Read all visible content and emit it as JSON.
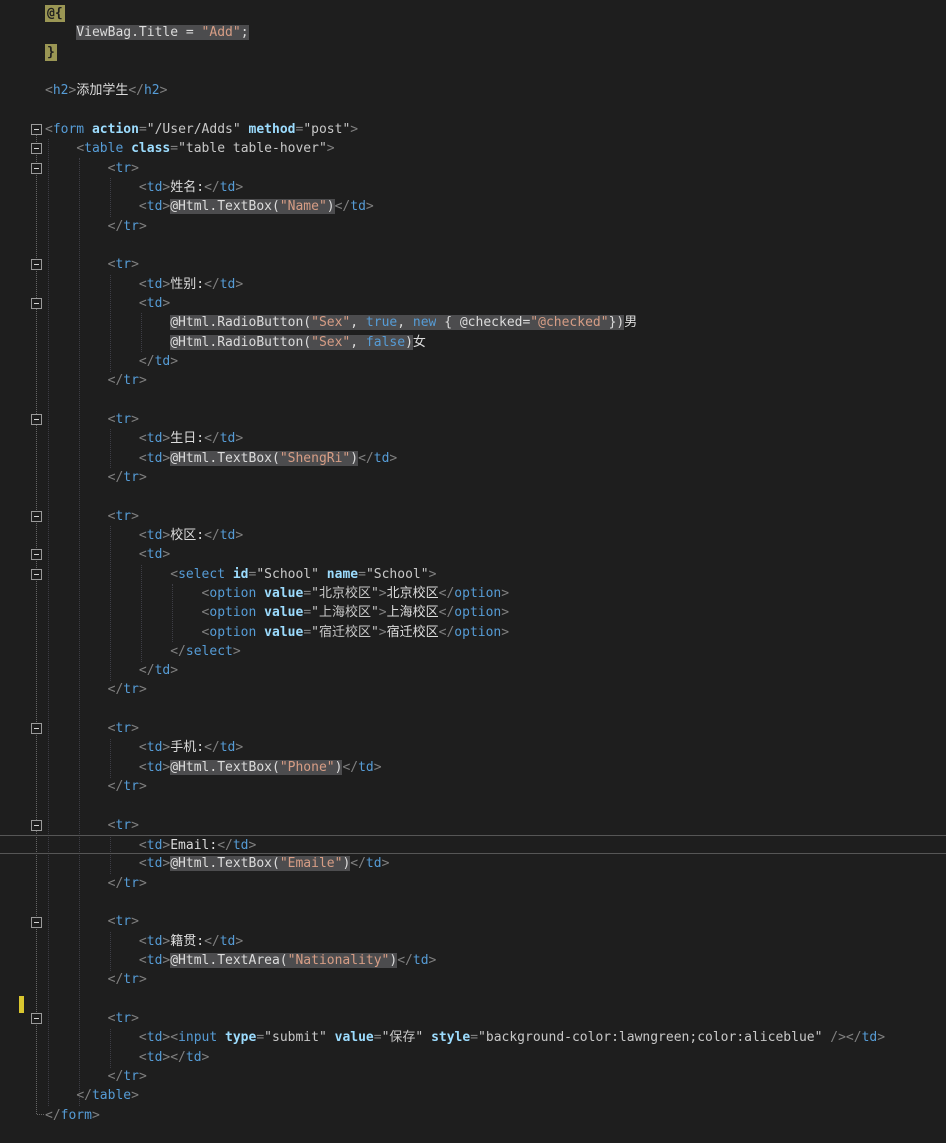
{
  "editor": {
    "file_type": "razor-cshtml-view",
    "current_line": 44,
    "modified_marker_line": 52,
    "fold_boxes": [
      7,
      8,
      9,
      14,
      16,
      22,
      27,
      29,
      30,
      38,
      43,
      48,
      53
    ],
    "colors": {
      "background": "#1e1e1e",
      "html_tag": "#569cd6",
      "html_delimiter": "#808080",
      "html_attribute": "#9cdcfe",
      "html_attribute_value": "#c8c8c8",
      "html_text": "#dcdcdc",
      "razor_background": "#4c4c4e",
      "razor_string": "#d69d85",
      "razor_keyword": "#569cd6",
      "razor_transition_background": "#9a9654",
      "current_line_border": "#565656",
      "modified_marker": "#d9c62f"
    },
    "lines": [
      [
        [
          "tr",
          "@{"
        ]
      ],
      [
        [
          "x",
          "    "
        ],
        [
          "rz",
          "ViewBag.Title = "
        ],
        [
          "rs",
          "\"Add\""
        ],
        [
          "rz",
          ";"
        ]
      ],
      [
        [
          "tr",
          "}"
        ]
      ],
      [],
      [
        [
          "d",
          "<"
        ],
        [
          "t",
          "h2"
        ],
        [
          "d",
          ">"
        ],
        [
          "x",
          "添加学生"
        ],
        [
          "d",
          "</"
        ],
        [
          "t",
          "h2"
        ],
        [
          "d",
          ">"
        ]
      ],
      [],
      [
        [
          "d",
          "<"
        ],
        [
          "t",
          "form"
        ],
        [
          "x",
          " "
        ],
        [
          "a",
          "action"
        ],
        [
          "d",
          "="
        ],
        [
          "v",
          "\"/User/Adds\""
        ],
        [
          "x",
          " "
        ],
        [
          "a",
          "method"
        ],
        [
          "d",
          "="
        ],
        [
          "v",
          "\"post\""
        ],
        [
          "d",
          ">"
        ]
      ],
      [
        [
          "x",
          "    "
        ],
        [
          "d",
          "<"
        ],
        [
          "t",
          "table"
        ],
        [
          "x",
          " "
        ],
        [
          "a",
          "class"
        ],
        [
          "d",
          "="
        ],
        [
          "v",
          "\"table table-hover\""
        ],
        [
          "d",
          ">"
        ]
      ],
      [
        [
          "x",
          "        "
        ],
        [
          "d",
          "<"
        ],
        [
          "t",
          "tr"
        ],
        [
          "d",
          ">"
        ]
      ],
      [
        [
          "x",
          "            "
        ],
        [
          "d",
          "<"
        ],
        [
          "t",
          "td"
        ],
        [
          "d",
          ">"
        ],
        [
          "x",
          "姓名:"
        ],
        [
          "d",
          "</"
        ],
        [
          "t",
          "td"
        ],
        [
          "d",
          ">"
        ]
      ],
      [
        [
          "x",
          "            "
        ],
        [
          "d",
          "<"
        ],
        [
          "t",
          "td"
        ],
        [
          "d",
          ">"
        ],
        [
          "rz",
          "@Html.TextBox("
        ],
        [
          "rs",
          "\"Name\""
        ],
        [
          "rz",
          ")"
        ],
        [
          "d",
          "</"
        ],
        [
          "t",
          "td"
        ],
        [
          "d",
          ">"
        ]
      ],
      [
        [
          "x",
          "        "
        ],
        [
          "d",
          "</"
        ],
        [
          "t",
          "tr"
        ],
        [
          "d",
          ">"
        ]
      ],
      [],
      [
        [
          "x",
          "        "
        ],
        [
          "d",
          "<"
        ],
        [
          "t",
          "tr"
        ],
        [
          "d",
          ">"
        ]
      ],
      [
        [
          "x",
          "            "
        ],
        [
          "d",
          "<"
        ],
        [
          "t",
          "td"
        ],
        [
          "d",
          ">"
        ],
        [
          "x",
          "性别:"
        ],
        [
          "d",
          "</"
        ],
        [
          "t",
          "td"
        ],
        [
          "d",
          ">"
        ]
      ],
      [
        [
          "x",
          "            "
        ],
        [
          "d",
          "<"
        ],
        [
          "t",
          "td"
        ],
        [
          "d",
          ">"
        ]
      ],
      [
        [
          "x",
          "                "
        ],
        [
          "rz",
          "@Html.RadioButton("
        ],
        [
          "rs",
          "\"Sex\""
        ],
        [
          "rz",
          ", "
        ],
        [
          "rk",
          "true"
        ],
        [
          "rz",
          ", "
        ],
        [
          "rk",
          "new"
        ],
        [
          "rz",
          " { @checked="
        ],
        [
          "rs",
          "\"@checked\""
        ],
        [
          "rz",
          "})"
        ],
        [
          "x",
          "男"
        ]
      ],
      [
        [
          "x",
          "                "
        ],
        [
          "rz",
          "@Html.RadioButton("
        ],
        [
          "rs",
          "\"Sex\""
        ],
        [
          "rz",
          ", "
        ],
        [
          "rk",
          "false"
        ],
        [
          "rz",
          ")"
        ],
        [
          "x",
          "女"
        ]
      ],
      [
        [
          "x",
          "            "
        ],
        [
          "d",
          "</"
        ],
        [
          "t",
          "td"
        ],
        [
          "d",
          ">"
        ]
      ],
      [
        [
          "x",
          "        "
        ],
        [
          "d",
          "</"
        ],
        [
          "t",
          "tr"
        ],
        [
          "d",
          ">"
        ]
      ],
      [],
      [
        [
          "x",
          "        "
        ],
        [
          "d",
          "<"
        ],
        [
          "t",
          "tr"
        ],
        [
          "d",
          ">"
        ]
      ],
      [
        [
          "x",
          "            "
        ],
        [
          "d",
          "<"
        ],
        [
          "t",
          "td"
        ],
        [
          "d",
          ">"
        ],
        [
          "x",
          "生日:"
        ],
        [
          "d",
          "</"
        ],
        [
          "t",
          "td"
        ],
        [
          "d",
          ">"
        ]
      ],
      [
        [
          "x",
          "            "
        ],
        [
          "d",
          "<"
        ],
        [
          "t",
          "td"
        ],
        [
          "d",
          ">"
        ],
        [
          "rz",
          "@Html.TextBox("
        ],
        [
          "rs",
          "\"ShengRi\""
        ],
        [
          "rz",
          ")"
        ],
        [
          "d",
          "</"
        ],
        [
          "t",
          "td"
        ],
        [
          "d",
          ">"
        ]
      ],
      [
        [
          "x",
          "        "
        ],
        [
          "d",
          "</"
        ],
        [
          "t",
          "tr"
        ],
        [
          "d",
          ">"
        ]
      ],
      [],
      [
        [
          "x",
          "        "
        ],
        [
          "d",
          "<"
        ],
        [
          "t",
          "tr"
        ],
        [
          "d",
          ">"
        ]
      ],
      [
        [
          "x",
          "            "
        ],
        [
          "d",
          "<"
        ],
        [
          "t",
          "td"
        ],
        [
          "d",
          ">"
        ],
        [
          "x",
          "校区:"
        ],
        [
          "d",
          "</"
        ],
        [
          "t",
          "td"
        ],
        [
          "d",
          ">"
        ]
      ],
      [
        [
          "x",
          "            "
        ],
        [
          "d",
          "<"
        ],
        [
          "t",
          "td"
        ],
        [
          "d",
          ">"
        ]
      ],
      [
        [
          "x",
          "                "
        ],
        [
          "d",
          "<"
        ],
        [
          "t",
          "select"
        ],
        [
          "x",
          " "
        ],
        [
          "a",
          "id"
        ],
        [
          "d",
          "="
        ],
        [
          "v",
          "\"School\""
        ],
        [
          "x",
          " "
        ],
        [
          "a",
          "name"
        ],
        [
          "d",
          "="
        ],
        [
          "v",
          "\"School\""
        ],
        [
          "d",
          ">"
        ]
      ],
      [
        [
          "x",
          "                    "
        ],
        [
          "d",
          "<"
        ],
        [
          "t",
          "option"
        ],
        [
          "x",
          " "
        ],
        [
          "a",
          "value"
        ],
        [
          "d",
          "="
        ],
        [
          "v",
          "\"北京校区\""
        ],
        [
          "d",
          ">"
        ],
        [
          "x",
          "北京校区"
        ],
        [
          "d",
          "</"
        ],
        [
          "t",
          "option"
        ],
        [
          "d",
          ">"
        ]
      ],
      [
        [
          "x",
          "                    "
        ],
        [
          "d",
          "<"
        ],
        [
          "t",
          "option"
        ],
        [
          "x",
          " "
        ],
        [
          "a",
          "value"
        ],
        [
          "d",
          "="
        ],
        [
          "v",
          "\"上海校区\""
        ],
        [
          "d",
          ">"
        ],
        [
          "x",
          "上海校区"
        ],
        [
          "d",
          "</"
        ],
        [
          "t",
          "option"
        ],
        [
          "d",
          ">"
        ]
      ],
      [
        [
          "x",
          "                    "
        ],
        [
          "d",
          "<"
        ],
        [
          "t",
          "option"
        ],
        [
          "x",
          " "
        ],
        [
          "a",
          "value"
        ],
        [
          "d",
          "="
        ],
        [
          "v",
          "\"宿迁校区\""
        ],
        [
          "d",
          ">"
        ],
        [
          "x",
          "宿迁校区"
        ],
        [
          "d",
          "</"
        ],
        [
          "t",
          "option"
        ],
        [
          "d",
          ">"
        ]
      ],
      [
        [
          "x",
          "                "
        ],
        [
          "d",
          "</"
        ],
        [
          "t",
          "select"
        ],
        [
          "d",
          ">"
        ]
      ],
      [
        [
          "x",
          "            "
        ],
        [
          "d",
          "</"
        ],
        [
          "t",
          "td"
        ],
        [
          "d",
          ">"
        ]
      ],
      [
        [
          "x",
          "        "
        ],
        [
          "d",
          "</"
        ],
        [
          "t",
          "tr"
        ],
        [
          "d",
          ">"
        ]
      ],
      [],
      [
        [
          "x",
          "        "
        ],
        [
          "d",
          "<"
        ],
        [
          "t",
          "tr"
        ],
        [
          "d",
          ">"
        ]
      ],
      [
        [
          "x",
          "            "
        ],
        [
          "d",
          "<"
        ],
        [
          "t",
          "td"
        ],
        [
          "d",
          ">"
        ],
        [
          "x",
          "手机:"
        ],
        [
          "d",
          "</"
        ],
        [
          "t",
          "td"
        ],
        [
          "d",
          ">"
        ]
      ],
      [
        [
          "x",
          "            "
        ],
        [
          "d",
          "<"
        ],
        [
          "t",
          "td"
        ],
        [
          "d",
          ">"
        ],
        [
          "rz",
          "@Html.TextBox("
        ],
        [
          "rs",
          "\"Phone\""
        ],
        [
          "rz",
          ")"
        ],
        [
          "d",
          "</"
        ],
        [
          "t",
          "td"
        ],
        [
          "d",
          ">"
        ]
      ],
      [
        [
          "x",
          "        "
        ],
        [
          "d",
          "</"
        ],
        [
          "t",
          "tr"
        ],
        [
          "d",
          ">"
        ]
      ],
      [],
      [
        [
          "x",
          "        "
        ],
        [
          "d",
          "<"
        ],
        [
          "t",
          "tr"
        ],
        [
          "d",
          ">"
        ]
      ],
      [
        [
          "x",
          "            "
        ],
        [
          "d",
          "<"
        ],
        [
          "t",
          "td"
        ],
        [
          "d",
          ">"
        ],
        [
          "x",
          "Email:"
        ],
        [
          "d",
          "</"
        ],
        [
          "t",
          "td"
        ],
        [
          "d",
          ">"
        ]
      ],
      [
        [
          "x",
          "            "
        ],
        [
          "d",
          "<"
        ],
        [
          "t",
          "td"
        ],
        [
          "d",
          ">"
        ],
        [
          "rz",
          "@Html.TextBox("
        ],
        [
          "rs",
          "\"Emaile\""
        ],
        [
          "rz",
          ")"
        ],
        [
          "d",
          "</"
        ],
        [
          "t",
          "td"
        ],
        [
          "d",
          ">"
        ]
      ],
      [
        [
          "x",
          "        "
        ],
        [
          "d",
          "</"
        ],
        [
          "t",
          "tr"
        ],
        [
          "d",
          ">"
        ]
      ],
      [],
      [
        [
          "x",
          "        "
        ],
        [
          "d",
          "<"
        ],
        [
          "t",
          "tr"
        ],
        [
          "d",
          ">"
        ]
      ],
      [
        [
          "x",
          "            "
        ],
        [
          "d",
          "<"
        ],
        [
          "t",
          "td"
        ],
        [
          "d",
          ">"
        ],
        [
          "x",
          "籍贯:"
        ],
        [
          "d",
          "</"
        ],
        [
          "t",
          "td"
        ],
        [
          "d",
          ">"
        ]
      ],
      [
        [
          "x",
          "            "
        ],
        [
          "d",
          "<"
        ],
        [
          "t",
          "td"
        ],
        [
          "d",
          ">"
        ],
        [
          "rz",
          "@Html.TextArea("
        ],
        [
          "rs",
          "\"Nationality\""
        ],
        [
          "rz",
          ")"
        ],
        [
          "d",
          "</"
        ],
        [
          "t",
          "td"
        ],
        [
          "d",
          ">"
        ]
      ],
      [
        [
          "x",
          "        "
        ],
        [
          "d",
          "</"
        ],
        [
          "t",
          "tr"
        ],
        [
          "d",
          ">"
        ]
      ],
      [],
      [
        [
          "x",
          "        "
        ],
        [
          "d",
          "<"
        ],
        [
          "t",
          "tr"
        ],
        [
          "d",
          ">"
        ]
      ],
      [
        [
          "x",
          "            "
        ],
        [
          "d",
          "<"
        ],
        [
          "t",
          "td"
        ],
        [
          "d",
          ">"
        ],
        [
          "d",
          "<"
        ],
        [
          "t",
          "input"
        ],
        [
          "x",
          " "
        ],
        [
          "a",
          "type"
        ],
        [
          "d",
          "="
        ],
        [
          "v",
          "\"submit\""
        ],
        [
          "x",
          " "
        ],
        [
          "a",
          "value"
        ],
        [
          "d",
          "="
        ],
        [
          "v",
          "\"保存\""
        ],
        [
          "x",
          " "
        ],
        [
          "a",
          "style"
        ],
        [
          "d",
          "="
        ],
        [
          "v",
          "\"background-color:lawngreen;color:aliceblue\""
        ],
        [
          "x",
          " "
        ],
        [
          "d",
          "/>"
        ],
        [
          "d",
          "</"
        ],
        [
          "t",
          "td"
        ],
        [
          "d",
          ">"
        ]
      ],
      [
        [
          "x",
          "            "
        ],
        [
          "d",
          "<"
        ],
        [
          "t",
          "td"
        ],
        [
          "d",
          ">"
        ],
        [
          "d",
          "</"
        ],
        [
          "t",
          "td"
        ],
        [
          "d",
          ">"
        ]
      ],
      [
        [
          "x",
          "        "
        ],
        [
          "d",
          "</"
        ],
        [
          "t",
          "tr"
        ],
        [
          "d",
          ">"
        ]
      ],
      [
        [
          "x",
          "    "
        ],
        [
          "d",
          "</"
        ],
        [
          "t",
          "table"
        ],
        [
          "d",
          ">"
        ]
      ],
      [
        [
          "d",
          "</"
        ],
        [
          "t",
          "form"
        ],
        [
          "d",
          ">"
        ]
      ]
    ]
  }
}
